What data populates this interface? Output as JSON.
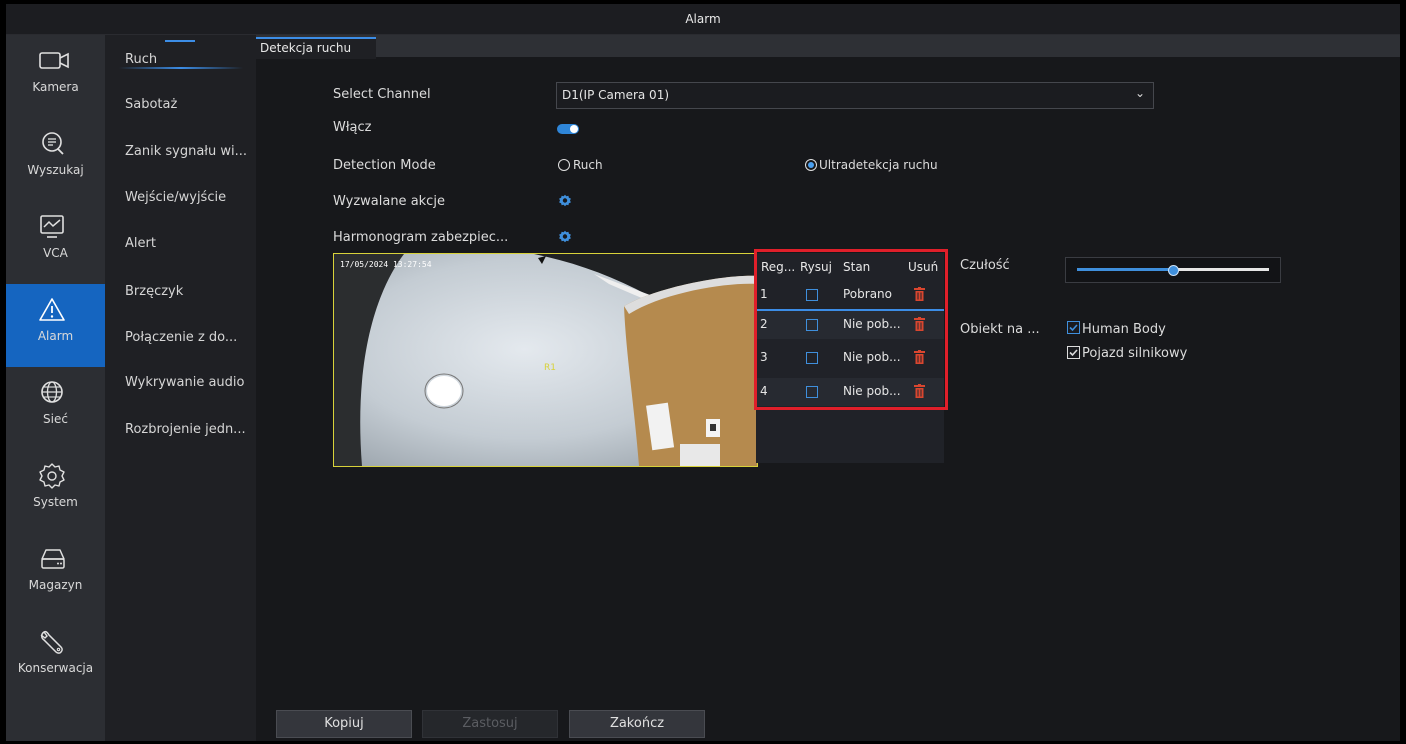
{
  "window": {
    "title": "Alarm"
  },
  "nav": {
    "items": [
      {
        "label": "Kamera",
        "icon": "camera-icon"
      },
      {
        "label": "Wyszukaj",
        "icon": "search-icon"
      },
      {
        "label": "VCA",
        "icon": "vca-monitor-icon"
      },
      {
        "label": "Alarm",
        "icon": "alarm-warning-icon",
        "active": true
      },
      {
        "label": "Sieć",
        "icon": "globe-icon"
      },
      {
        "label": "System",
        "icon": "gear-icon"
      },
      {
        "label": "Magazyn",
        "icon": "storage-drive-icon"
      },
      {
        "label": "Konserwacja",
        "icon": "wrench-icon"
      }
    ]
  },
  "submenu": {
    "items": [
      {
        "label": "Ruch",
        "active": true
      },
      {
        "label": "Sabotaż"
      },
      {
        "label": "Zanik sygnału wi..."
      },
      {
        "label": "Wejście/wyjście"
      },
      {
        "label": "Alert"
      },
      {
        "label": "Brzęczyk"
      },
      {
        "label": "Połączenie z do..."
      },
      {
        "label": "Wykrywanie audio"
      },
      {
        "label": "Rozbrojenie jedn..."
      }
    ]
  },
  "tabs": [
    {
      "label": "Detekcja ruchu",
      "active": true
    }
  ],
  "form": {
    "select_channel": {
      "label": "Select Channel",
      "value": "D1(IP Camera 01)"
    },
    "enable": {
      "label": "Włącz",
      "on": true
    },
    "detection_mode": {
      "label": "Detection Mode",
      "options": [
        "Ruch",
        "Ultradetekcja ruchu"
      ],
      "selected": "Ultradetekcja ruchu"
    },
    "triggered_actions": {
      "label": "Wyzwalane akcje"
    },
    "schedule": {
      "label": "Harmonogram zabezpiec..."
    }
  },
  "preview": {
    "timestamp": "17/05/2024 13:27:54",
    "region_marker": "R1"
  },
  "regions": {
    "headers": [
      "Reg...",
      "Rysuj",
      "Stan",
      "Usuń"
    ],
    "rows": [
      {
        "id": "1",
        "status": "Pobrano"
      },
      {
        "id": "2",
        "status": "Nie pob..."
      },
      {
        "id": "3",
        "status": "Nie pob..."
      },
      {
        "id": "4",
        "status": "Nie pob..."
      }
    ]
  },
  "sensitivity": {
    "label": "Czułość",
    "level": 0.5
  },
  "objects": {
    "label": "Obiekt na ...",
    "options": [
      {
        "label": "Human Body",
        "checked": true
      },
      {
        "label": "Pojazd silnikowy",
        "checked": true
      }
    ]
  },
  "buttons": {
    "copy": "Kopiuj",
    "apply": "Zastosuj",
    "finish": "Zakończ"
  },
  "colors": {
    "accent": "#3f8fdc",
    "active_nav": "#1565c0",
    "highlight_box": "#e01f2a",
    "delete_icon": "#d9462f"
  }
}
